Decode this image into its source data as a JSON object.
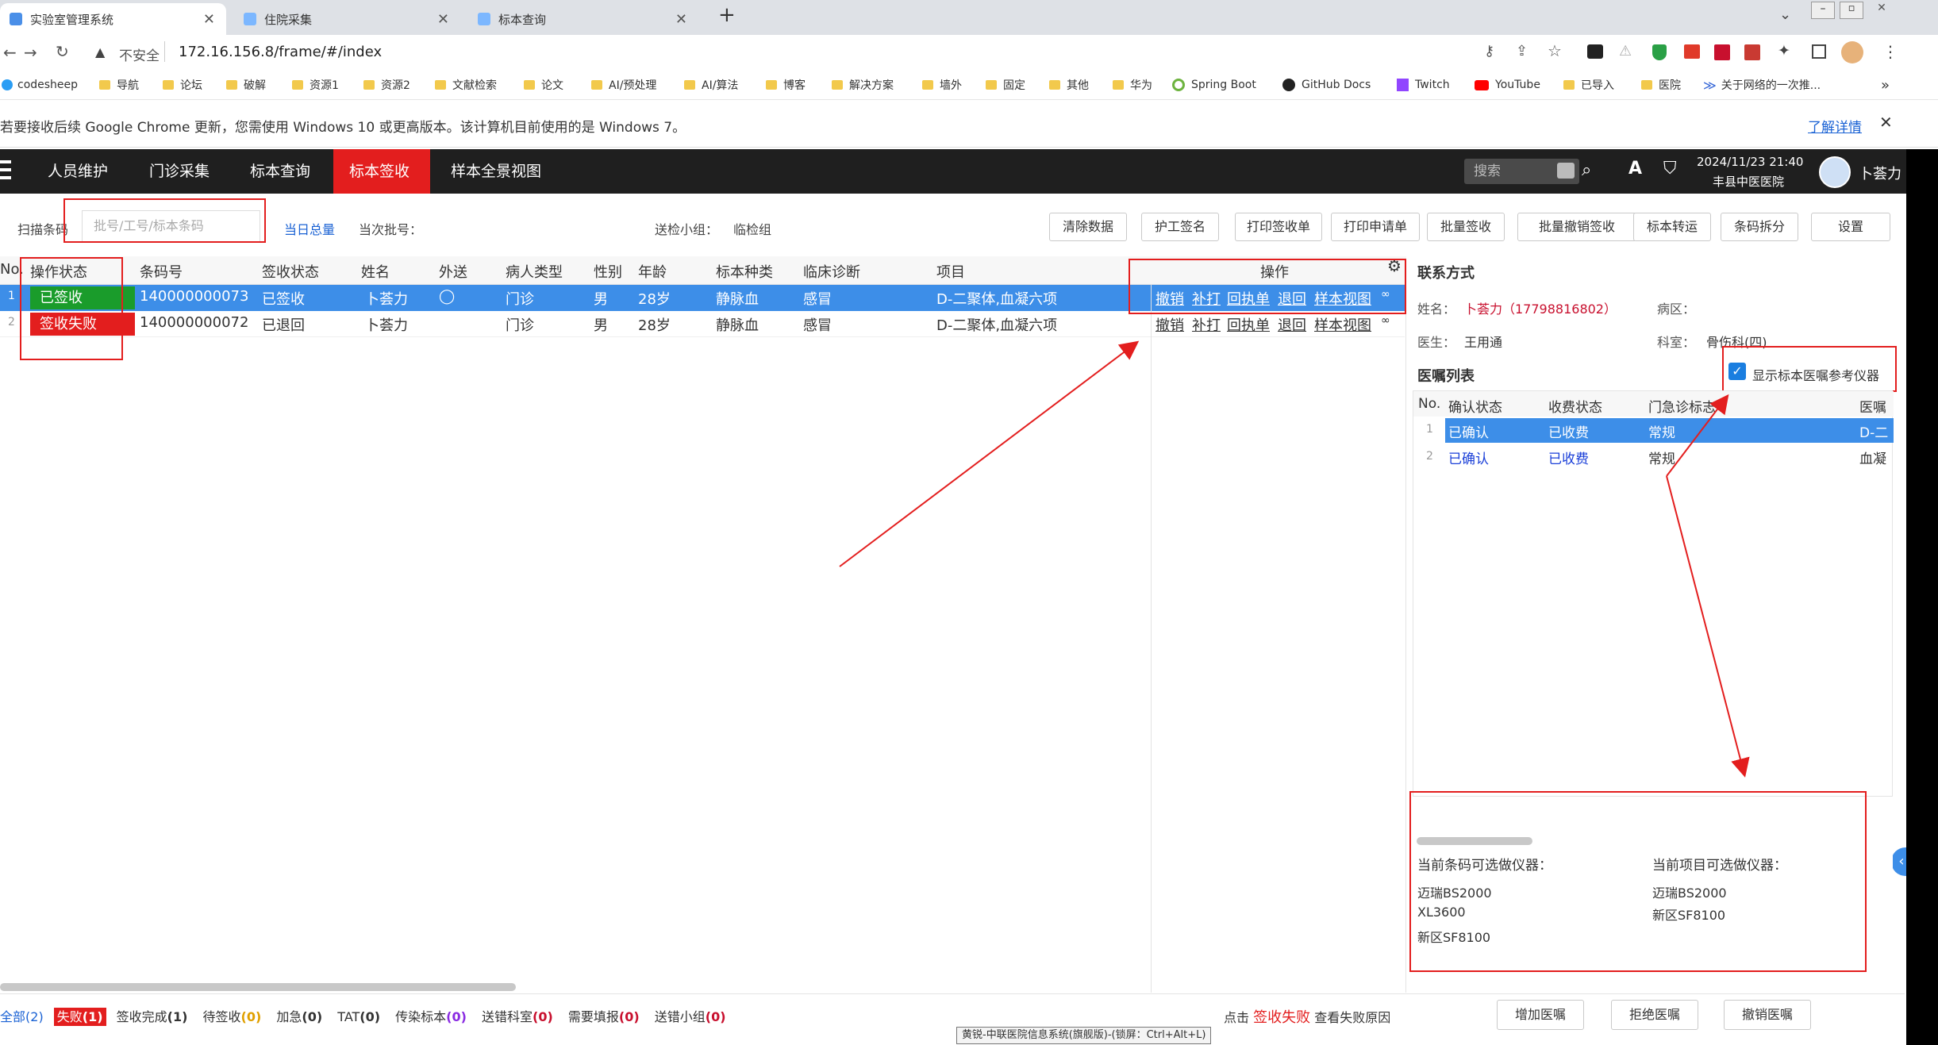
{
  "browser": {
    "tabs": [
      {
        "label": "实验室管理系统"
      },
      {
        "label": "住院采集"
      },
      {
        "label": "标本查询"
      }
    ],
    "new_tab": "+",
    "security": "不安全",
    "url": "172.16.156.8/frame/#/index",
    "bookmarks": [
      "codesheep",
      "导航",
      "论坛",
      "破解",
      "资源1",
      "资源2",
      "文献检索",
      "论文",
      "AI/预处理",
      "AI/算法",
      "博客",
      "解决方案",
      "墙外",
      "固定",
      "其他",
      "华为",
      "Spring Boot",
      "GitHub Docs",
      "Twitch",
      "YouTube",
      "已导入",
      "医院",
      "关于网络的一次推..."
    ],
    "bookmarks_more": "»",
    "infobar_text": "若要接收后续 Google Chrome 更新，您需使用 Windows 10 或更高版本。该计算机目前使用的是 Windows 7。",
    "infobar_link": "了解详情"
  },
  "app": {
    "nav": [
      "人员维护",
      "门诊采集",
      "标本查询",
      "标本签收",
      "样本全景视图"
    ],
    "search_placeholder": "搜索",
    "datetime": "2024/11/23 21:40",
    "hospital": "丰县中医医院",
    "user": "卜荟力",
    "font_icon": "A",
    "scan_label": "扫描条码",
    "scan_placeholder": "批号/工号/标本条码",
    "day_total": "当日总量",
    "batch_label": "当次批号：",
    "group_label": "送检小组：",
    "group_value": "临检组",
    "buttons": [
      "清除数据",
      "护工签名",
      "打印签收单",
      "打印申请单",
      "批量签收",
      "批量撤销签收",
      "标本转运",
      "条码拆分",
      "设置"
    ]
  },
  "grid": {
    "headers": [
      "No.",
      "操作状态",
      "条码号",
      "签收状态",
      "姓名",
      "外送",
      "病人类型",
      "性别",
      "年龄",
      "标本种类",
      "临床诊断",
      "项目",
      "操作"
    ],
    "rows": [
      {
        "no": "1",
        "op_status": "已签收",
        "barcode": "140000000073",
        "sign": "已签收",
        "name": "卜荟力",
        "send": "◯",
        "ptype": "门诊",
        "sex": "男",
        "age": "28岁",
        "kind": "静脉血",
        "diag": "感冒",
        "item": "D-二聚体,血凝六项"
      },
      {
        "no": "2",
        "op_status": "签收失败",
        "barcode": "140000000072",
        "sign": "已退回",
        "name": "卜荟力",
        "send": "",
        "ptype": "门诊",
        "sex": "男",
        "age": "28岁",
        "kind": "静脉血",
        "diag": "感冒",
        "item": "D-二聚体,血凝六项"
      }
    ],
    "actions": [
      "撤销",
      "补打",
      "回执单",
      "退回",
      "样本视图"
    ],
    "more": "∞"
  },
  "right": {
    "contact_title": "联系方式",
    "name_label": "姓名：",
    "name_value": "卜荟力（17798816802）",
    "ward_label": "病区：",
    "doctor_label": "医生：",
    "doctor_value": "王用通",
    "dept_label": "科室：",
    "dept_value": "骨伤科(四)",
    "orders_title": "医嘱列表",
    "show_instruments": "显示标本医嘱参考仪器",
    "order_headers": [
      "No.",
      "确认状态",
      "收费状态",
      "门急诊标志",
      "医嘱"
    ],
    "orders": [
      {
        "no": "1",
        "confirm": "已确认",
        "fee": "已收费",
        "flag": "常规",
        "order": "D-二"
      },
      {
        "no": "2",
        "confirm": "已确认",
        "fee": "已收费",
        "flag": "常规",
        "order": "血凝"
      }
    ],
    "barcode_instr_title": "当前条码可选做仪器：",
    "barcode_instr": [
      "迈瑞BS2000",
      "XL3600",
      "新区SF8100"
    ],
    "item_instr_title": "当前项目可选做仪器：",
    "item_instr": [
      "迈瑞BS2000",
      "新区SF8100"
    ]
  },
  "statusbar": {
    "filters": [
      {
        "label": "全部",
        "count": "(2)"
      },
      {
        "label": "失败",
        "count": "(1)"
      },
      {
        "label": "签收完成",
        "count": "(1)"
      },
      {
        "label": "待签收",
        "count": "(0)"
      },
      {
        "label": "加急",
        "count": "(0)"
      },
      {
        "label": "TAT",
        "count": "(0)"
      },
      {
        "label": "传染标本",
        "count": "(0)"
      },
      {
        "label": "送错科室",
        "count": "(0)"
      },
      {
        "label": "需要填报",
        "count": "(0)"
      },
      {
        "label": "送错小组",
        "count": "(0)"
      }
    ],
    "hint_pre": "点击",
    "hint_red": "签收失败",
    "hint_post": "查看失败原因",
    "buttons": [
      "增加医嘱",
      "拒绝医嘱",
      "撤销医嘱"
    ],
    "tooltip": "黄锐-中联医院信息系统(旗舰版)-(锁屏：Ctrl+Alt+L)"
  },
  "colors": {
    "accent": "#e31e1e",
    "selected": "#3d8ee8",
    "success": "#1a9c2b"
  }
}
